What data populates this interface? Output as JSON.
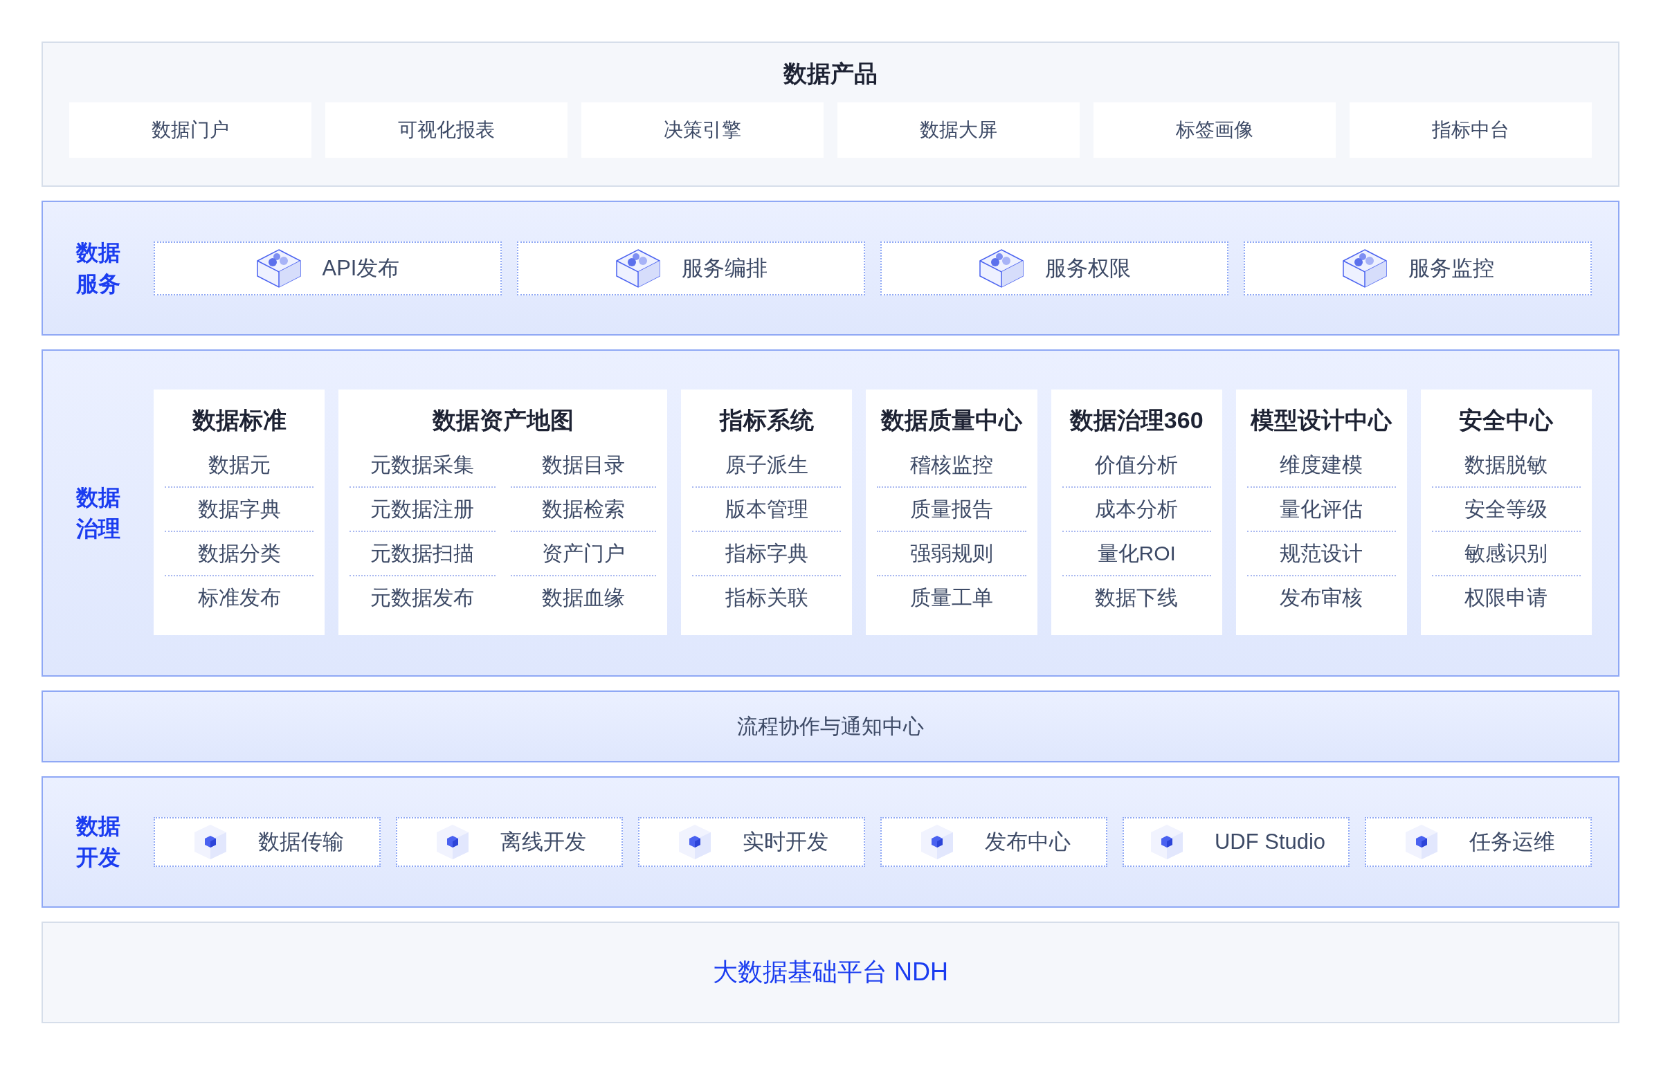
{
  "product_layer": {
    "title": "数据产品",
    "items": [
      "数据门户",
      "可视化报表",
      "决策引擎",
      "数据大屏",
      "标签画像",
      "指标中台"
    ]
  },
  "service_layer": {
    "label": "数据服务",
    "items": [
      "API发布",
      "服务编排",
      "服务权限",
      "服务监控"
    ]
  },
  "governance_layer": {
    "label": "数据治理",
    "modules": [
      {
        "title": "数据标准",
        "lists": [
          [
            "数据元",
            "数据字典",
            "数据分类",
            "标准发布"
          ]
        ]
      },
      {
        "title": "数据资产地图",
        "lists": [
          [
            "元数据采集",
            "元数据注册",
            "元数据扫描",
            "元数据发布"
          ],
          [
            "数据目录",
            "数据检索",
            "资产门户",
            "数据血缘"
          ]
        ]
      },
      {
        "title": "指标系统",
        "lists": [
          [
            "原子派生",
            "版本管理",
            "指标字典",
            "指标关联"
          ]
        ]
      },
      {
        "title": "数据质量中心",
        "lists": [
          [
            "稽核监控",
            "质量报告",
            "强弱规则",
            "质量工单"
          ]
        ]
      },
      {
        "title": "数据治理360",
        "lists": [
          [
            "价值分析",
            "成本分析",
            "量化ROI",
            "数据下线"
          ]
        ]
      },
      {
        "title": "模型设计中心",
        "lists": [
          [
            "维度建模",
            "量化评估",
            "规范设计",
            "发布审核"
          ]
        ]
      },
      {
        "title": "安全中心",
        "lists": [
          [
            "数据脱敏",
            "安全等级",
            "敏感识别",
            "权限申请"
          ]
        ]
      }
    ]
  },
  "workflow_bar": {
    "title": "流程协作与通知中心"
  },
  "dev_layer": {
    "label": "数据开发",
    "items": [
      "数据传输",
      "离线开发",
      "实时开发",
      "发布中心",
      "UDF Studio",
      "任务运维"
    ]
  },
  "platform": {
    "title": "大数据基础平台 NDH"
  }
}
